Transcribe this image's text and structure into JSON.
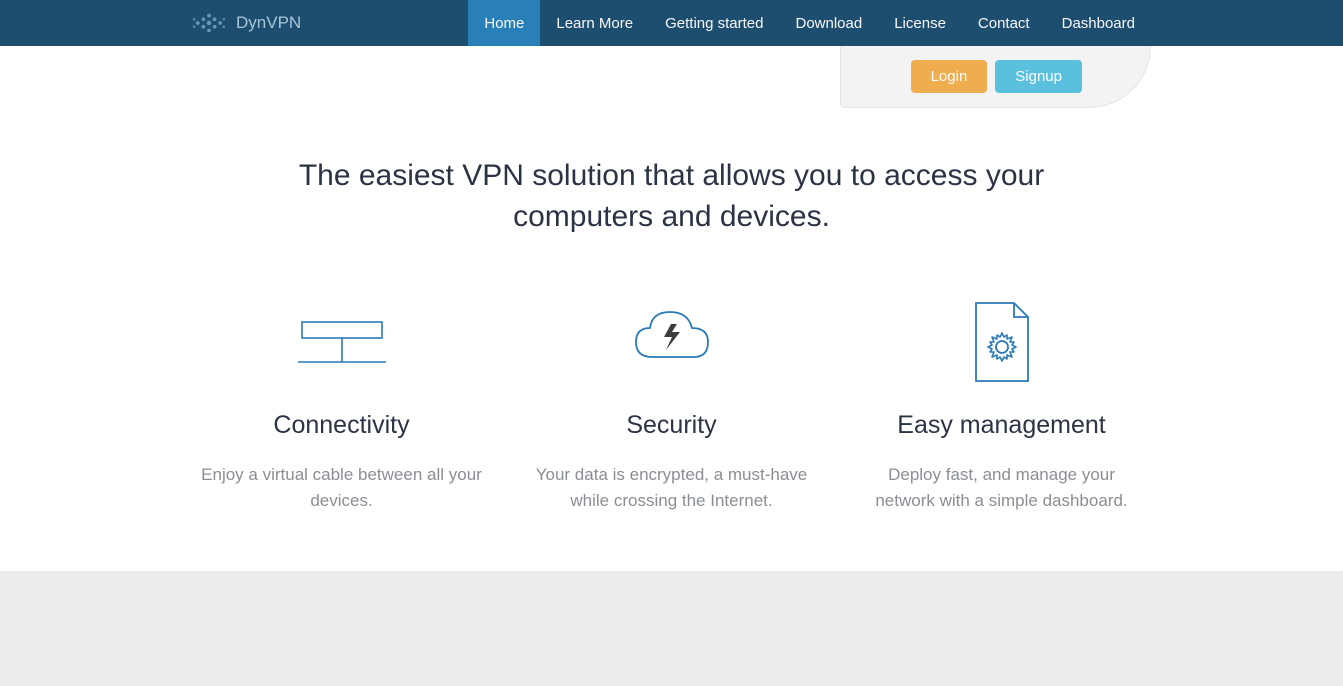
{
  "brand": {
    "name": "DynVPN"
  },
  "nav": {
    "items": [
      {
        "label": "Home",
        "active": true
      },
      {
        "label": "Learn More",
        "active": false
      },
      {
        "label": "Getting started",
        "active": false
      },
      {
        "label": "Download",
        "active": false
      },
      {
        "label": "License",
        "active": false
      },
      {
        "label": "Contact",
        "active": false
      },
      {
        "label": "Dashboard",
        "active": false
      }
    ]
  },
  "auth": {
    "login": "Login",
    "signup": "Signup"
  },
  "hero": {
    "headline": "The easiest VPN solution that allows you to access your computers and devices."
  },
  "features": [
    {
      "icon": "connectivity-icon",
      "title": "Connectivity",
      "desc": "Enjoy a virtual cable between all your devices."
    },
    {
      "icon": "security-icon",
      "title": "Security",
      "desc": "Your data is encrypted, a must-have while crossing the Internet."
    },
    {
      "icon": "management-icon",
      "title": "Easy management",
      "desc": "Deploy fast, and manage your network with a simple dashboard."
    }
  ],
  "colors": {
    "navbar": "#1d4d6f",
    "active": "#2980b9",
    "login": "#f0ad4e",
    "signup": "#5bc0de",
    "iconStroke": "#2a7ab8"
  }
}
